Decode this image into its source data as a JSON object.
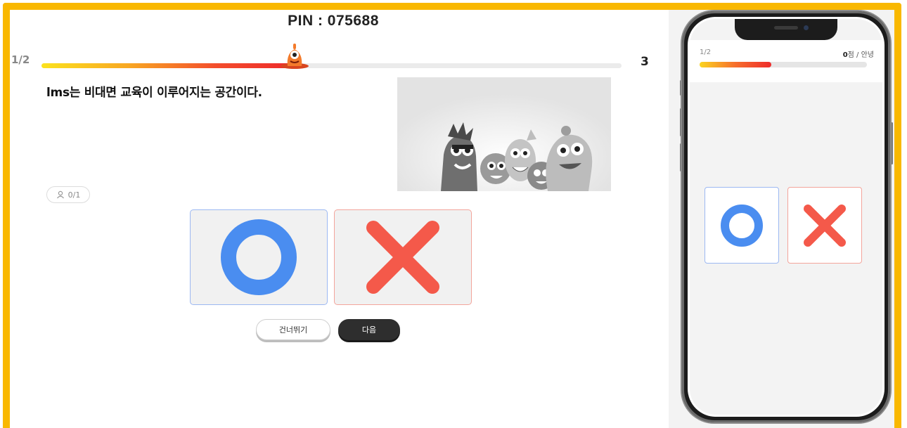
{
  "header": {
    "pin_text": "PIN : 075688",
    "question_index": "1/2",
    "question_count": "3",
    "progress_fraction": 0.43
  },
  "question": {
    "text": "lms는 비대면 교육이 이루어지는 공간이다.",
    "image_icon": "cartoon-characters-image"
  },
  "responses": {
    "icon": "person-icon",
    "text": "0/1"
  },
  "options": {
    "o_icon": "circle-o-icon",
    "x_icon": "cross-x-icon",
    "o_color": "#4a8df0",
    "x_color": "#f4594a"
  },
  "buttons": {
    "skip_label": "건너뛰기",
    "next_label": "다음"
  },
  "phone": {
    "question_index": "1/2",
    "score_value": "0",
    "score_suffix": "점 / 안녕",
    "progress_fraction": 0.43
  },
  "colors": {
    "frame": "#f9b800",
    "progress_start": "#fbe21e",
    "progress_end": "#ee2b2b"
  }
}
